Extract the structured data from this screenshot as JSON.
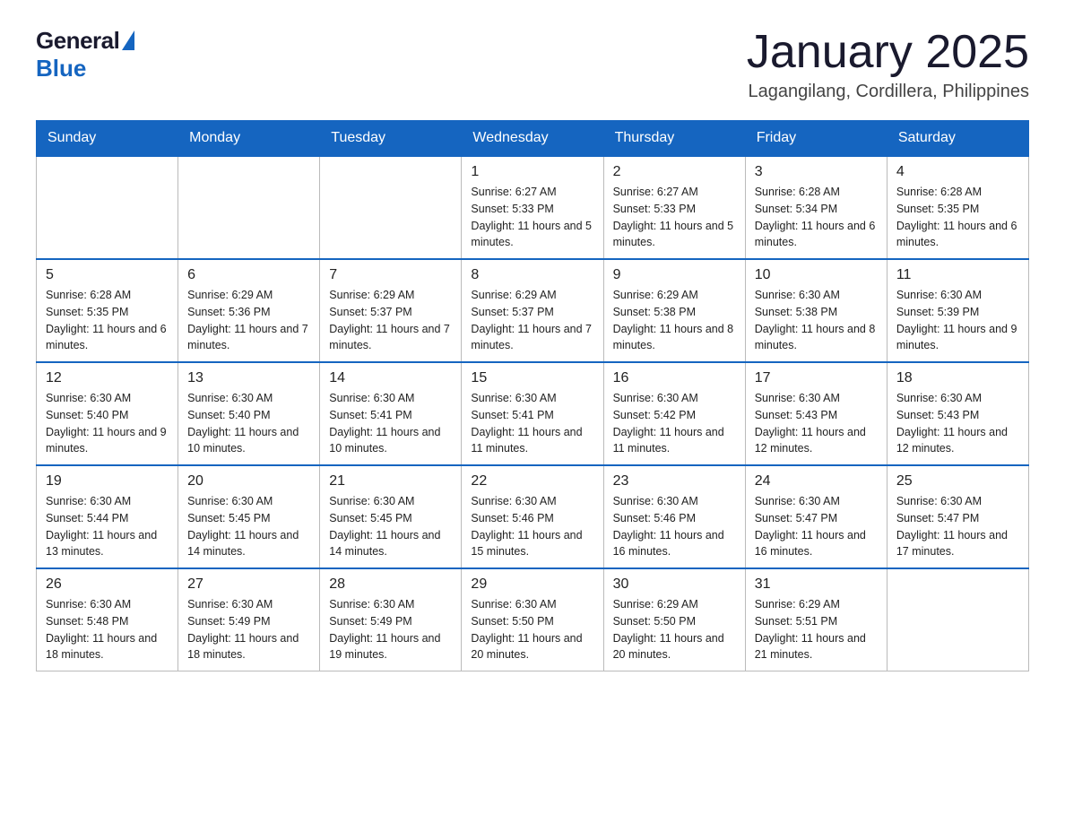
{
  "logo": {
    "general": "General",
    "blue": "Blue"
  },
  "header": {
    "month": "January 2025",
    "location": "Lagangilang, Cordillera, Philippines"
  },
  "weekdays": [
    "Sunday",
    "Monday",
    "Tuesday",
    "Wednesday",
    "Thursday",
    "Friday",
    "Saturday"
  ],
  "weeks": [
    [
      {
        "day": "",
        "info": ""
      },
      {
        "day": "",
        "info": ""
      },
      {
        "day": "",
        "info": ""
      },
      {
        "day": "1",
        "info": "Sunrise: 6:27 AM\nSunset: 5:33 PM\nDaylight: 11 hours and 5 minutes."
      },
      {
        "day": "2",
        "info": "Sunrise: 6:27 AM\nSunset: 5:33 PM\nDaylight: 11 hours and 5 minutes."
      },
      {
        "day": "3",
        "info": "Sunrise: 6:28 AM\nSunset: 5:34 PM\nDaylight: 11 hours and 6 minutes."
      },
      {
        "day": "4",
        "info": "Sunrise: 6:28 AM\nSunset: 5:35 PM\nDaylight: 11 hours and 6 minutes."
      }
    ],
    [
      {
        "day": "5",
        "info": "Sunrise: 6:28 AM\nSunset: 5:35 PM\nDaylight: 11 hours and 6 minutes."
      },
      {
        "day": "6",
        "info": "Sunrise: 6:29 AM\nSunset: 5:36 PM\nDaylight: 11 hours and 7 minutes."
      },
      {
        "day": "7",
        "info": "Sunrise: 6:29 AM\nSunset: 5:37 PM\nDaylight: 11 hours and 7 minutes."
      },
      {
        "day": "8",
        "info": "Sunrise: 6:29 AM\nSunset: 5:37 PM\nDaylight: 11 hours and 7 minutes."
      },
      {
        "day": "9",
        "info": "Sunrise: 6:29 AM\nSunset: 5:38 PM\nDaylight: 11 hours and 8 minutes."
      },
      {
        "day": "10",
        "info": "Sunrise: 6:30 AM\nSunset: 5:38 PM\nDaylight: 11 hours and 8 minutes."
      },
      {
        "day": "11",
        "info": "Sunrise: 6:30 AM\nSunset: 5:39 PM\nDaylight: 11 hours and 9 minutes."
      }
    ],
    [
      {
        "day": "12",
        "info": "Sunrise: 6:30 AM\nSunset: 5:40 PM\nDaylight: 11 hours and 9 minutes."
      },
      {
        "day": "13",
        "info": "Sunrise: 6:30 AM\nSunset: 5:40 PM\nDaylight: 11 hours and 10 minutes."
      },
      {
        "day": "14",
        "info": "Sunrise: 6:30 AM\nSunset: 5:41 PM\nDaylight: 11 hours and 10 minutes."
      },
      {
        "day": "15",
        "info": "Sunrise: 6:30 AM\nSunset: 5:41 PM\nDaylight: 11 hours and 11 minutes."
      },
      {
        "day": "16",
        "info": "Sunrise: 6:30 AM\nSunset: 5:42 PM\nDaylight: 11 hours and 11 minutes."
      },
      {
        "day": "17",
        "info": "Sunrise: 6:30 AM\nSunset: 5:43 PM\nDaylight: 11 hours and 12 minutes."
      },
      {
        "day": "18",
        "info": "Sunrise: 6:30 AM\nSunset: 5:43 PM\nDaylight: 11 hours and 12 minutes."
      }
    ],
    [
      {
        "day": "19",
        "info": "Sunrise: 6:30 AM\nSunset: 5:44 PM\nDaylight: 11 hours and 13 minutes."
      },
      {
        "day": "20",
        "info": "Sunrise: 6:30 AM\nSunset: 5:45 PM\nDaylight: 11 hours and 14 minutes."
      },
      {
        "day": "21",
        "info": "Sunrise: 6:30 AM\nSunset: 5:45 PM\nDaylight: 11 hours and 14 minutes."
      },
      {
        "day": "22",
        "info": "Sunrise: 6:30 AM\nSunset: 5:46 PM\nDaylight: 11 hours and 15 minutes."
      },
      {
        "day": "23",
        "info": "Sunrise: 6:30 AM\nSunset: 5:46 PM\nDaylight: 11 hours and 16 minutes."
      },
      {
        "day": "24",
        "info": "Sunrise: 6:30 AM\nSunset: 5:47 PM\nDaylight: 11 hours and 16 minutes."
      },
      {
        "day": "25",
        "info": "Sunrise: 6:30 AM\nSunset: 5:47 PM\nDaylight: 11 hours and 17 minutes."
      }
    ],
    [
      {
        "day": "26",
        "info": "Sunrise: 6:30 AM\nSunset: 5:48 PM\nDaylight: 11 hours and 18 minutes."
      },
      {
        "day": "27",
        "info": "Sunrise: 6:30 AM\nSunset: 5:49 PM\nDaylight: 11 hours and 18 minutes."
      },
      {
        "day": "28",
        "info": "Sunrise: 6:30 AM\nSunset: 5:49 PM\nDaylight: 11 hours and 19 minutes."
      },
      {
        "day": "29",
        "info": "Sunrise: 6:30 AM\nSunset: 5:50 PM\nDaylight: 11 hours and 20 minutes."
      },
      {
        "day": "30",
        "info": "Sunrise: 6:29 AM\nSunset: 5:50 PM\nDaylight: 11 hours and 20 minutes."
      },
      {
        "day": "31",
        "info": "Sunrise: 6:29 AM\nSunset: 5:51 PM\nDaylight: 11 hours and 21 minutes."
      },
      {
        "day": "",
        "info": ""
      }
    ]
  ]
}
